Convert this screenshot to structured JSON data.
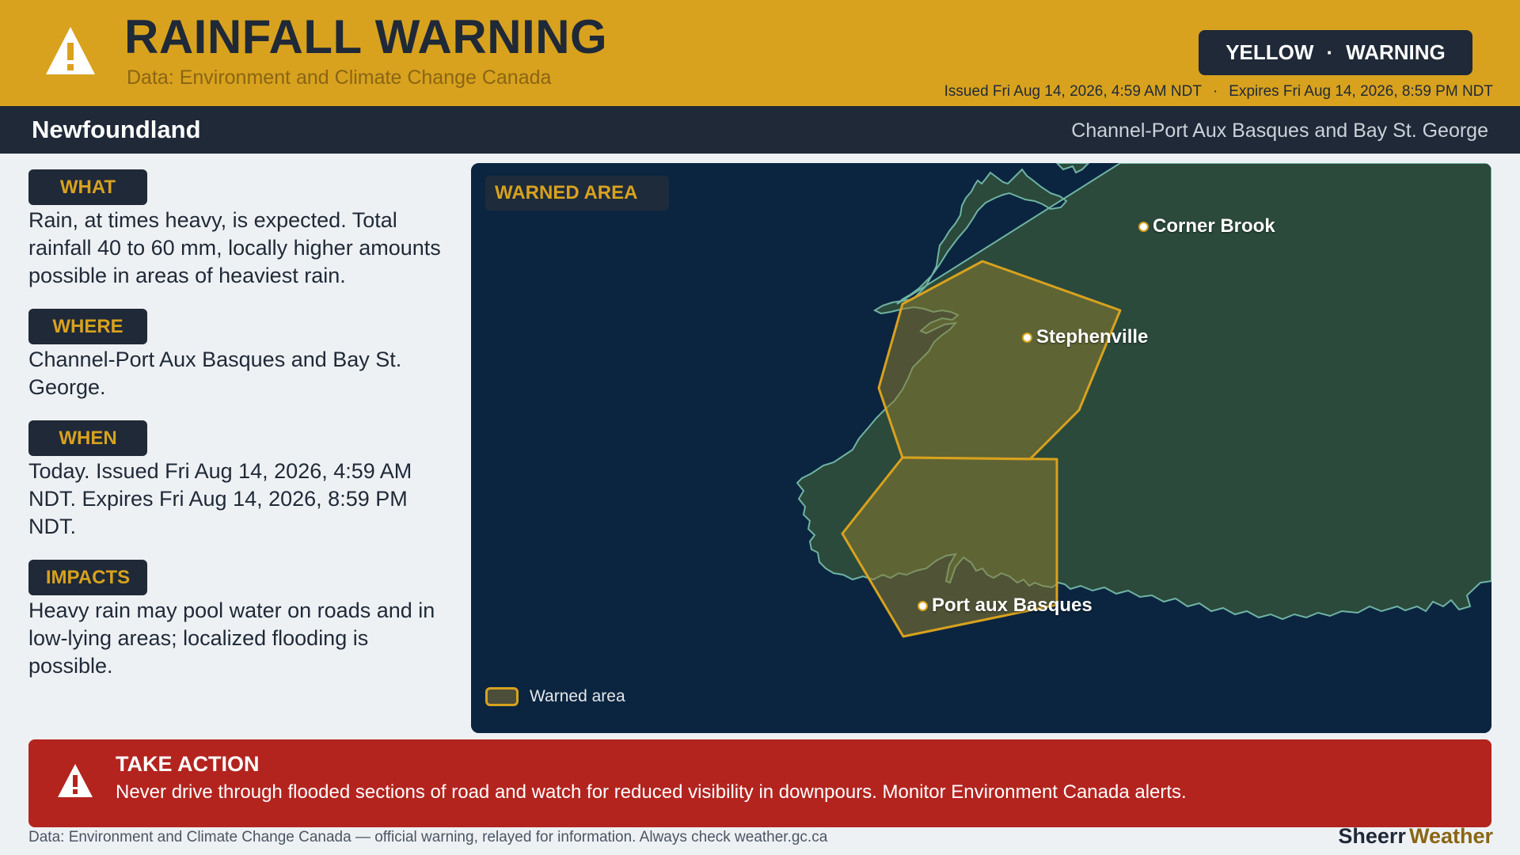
{
  "header": {
    "title": "RAINFALL WARNING",
    "subtitle": "Data: Environment and Climate Change Canada",
    "badge_level": "YELLOW",
    "badge_separator": "·",
    "badge_type": "WARNING",
    "issued": "Issued Fri Aug 14, 2026, 4:59 AM NDT",
    "meta_separator": "·",
    "expires": "Expires Fri Aug 14, 2026, 8:59 PM NDT",
    "icon": "warning-triangle-icon"
  },
  "region": {
    "name": "Newfoundland",
    "area": "Channel-Port Aux Basques and Bay St. George"
  },
  "sections": [
    {
      "tag": "WHAT",
      "text": "Rain, at times heavy, is expected. Total rainfall 40 to 60 mm, locally higher amounts possible in areas of heaviest rain."
    },
    {
      "tag": "WHERE",
      "text": "Channel-Port Aux Basques and Bay St. George."
    },
    {
      "tag": "WHEN",
      "text": "Today. Issued Fri Aug 14, 2026, 4:59 AM NDT. Expires Fri Aug 14, 2026, 8:59 PM NDT."
    },
    {
      "tag": "IMPACTS",
      "text": "Heavy rain may pool water on roads and in low-lying areas; localized flooding is possible."
    }
  ],
  "map": {
    "chip": "WARNED AREA",
    "legend_label": "Warned area",
    "cities": [
      "Corner Brook",
      "Stephenville",
      "Port aux Basques"
    ]
  },
  "action": {
    "title": "TAKE ACTION",
    "text": "Never drive through flooded sections of road and watch for reduced visibility in downpours. Monitor Environment Canada alerts.",
    "icon": "warning-triangle-icon"
  },
  "footer": {
    "source": "Data: Environment and Climate Change Canada — official warning, relayed for information. Always check weather.gc.ca",
    "brand_part1": "Sheerr",
    "brand_part2": "Weather"
  },
  "colors": {
    "accent": "#d8a21e",
    "dark": "#1f2937",
    "action_red": "#b3241f",
    "map_water": "#0b2540",
    "map_land": "#2b4a3c"
  }
}
